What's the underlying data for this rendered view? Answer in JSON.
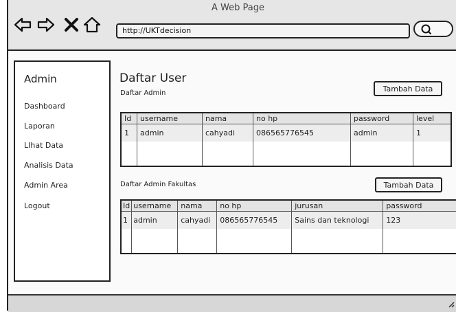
{
  "window": {
    "title": "A Web Page"
  },
  "toolbar": {
    "url": "http://UKTdecision"
  },
  "sidebar": {
    "title": "Admin",
    "items": [
      {
        "label": "Dashboard"
      },
      {
        "label": "Laporan"
      },
      {
        "label": "LIhat Data"
      },
      {
        "label": "Analisis Data"
      },
      {
        "label": "Admin Area"
      },
      {
        "label": "Logout"
      }
    ]
  },
  "main": {
    "title": "Daftar User",
    "section1": {
      "label": "Daftar Admin",
      "button": "Tambah Data",
      "headers": [
        "Id",
        "username",
        "nama",
        "no hp",
        "password",
        "level"
      ],
      "rows": [
        [
          "1",
          "admin",
          "cahyadi",
          "086565776545",
          "admin",
          "1"
        ]
      ]
    },
    "section2": {
      "label": "Daftar Admin Fakultas",
      "button": "Tambah Data",
      "headers": [
        "Id",
        "username",
        "nama",
        "no hp",
        "jurusan",
        "password"
      ],
      "rows": [
        [
          "1",
          "admin",
          "cahyadi",
          "086565776545",
          "Sains dan teknologi",
          "123"
        ]
      ]
    }
  },
  "icons": [
    "back-icon",
    "forward-icon",
    "close-icon",
    "home-icon",
    "search-icon",
    "resize-grip-icon"
  ]
}
